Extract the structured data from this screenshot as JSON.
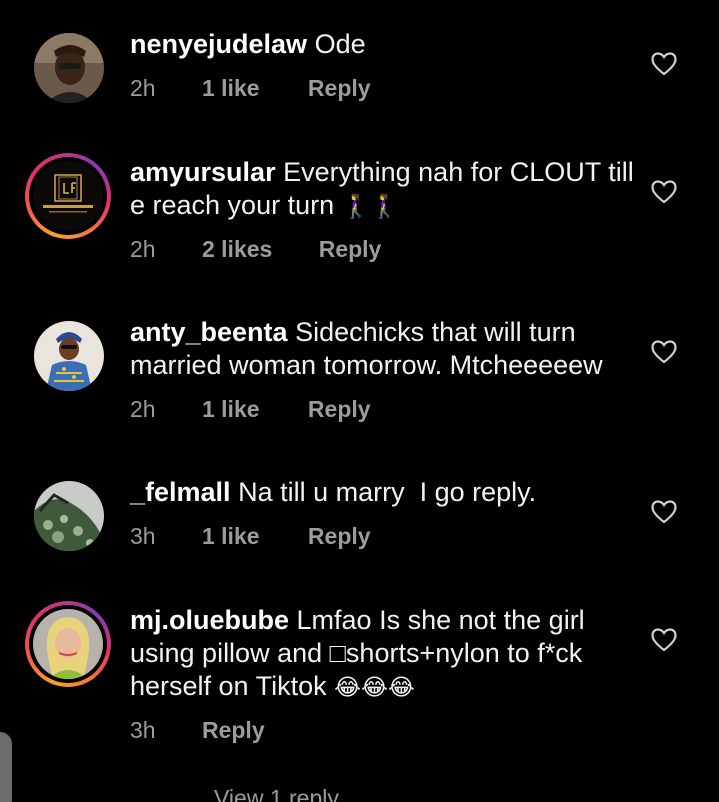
{
  "comments": [
    {
      "username": "nenyejudelaw",
      "text": "Ode",
      "time": "2h",
      "likes": "1 like",
      "reply": "Reply",
      "emoji": ""
    },
    {
      "username": "amyursular",
      "text": "Everything nah for CLOUT till e reach your turn",
      "time": "2h",
      "likes": "2 likes",
      "reply": "Reply",
      "emoji": "🚶‍♀️🚶‍♀️"
    },
    {
      "username": "anty_beenta",
      "text": "Sidechicks that will turn married woman tomorrow. Mtcheeeeew",
      "time": "2h",
      "likes": "1 like",
      "reply": "Reply",
      "emoji": ""
    },
    {
      "username": "_felmall",
      "text": "Na till u marry  I go reply.",
      "time": "3h",
      "likes": "1 like",
      "reply": "Reply",
      "emoji": ""
    },
    {
      "username": "mj.oluebube",
      "text": "Lmfao Is she not the girl using pillow and □shorts+nylon to f*ck herself on Tiktok",
      "time": "3h",
      "likes": "",
      "reply": "Reply",
      "emoji": "😂😂😂"
    }
  ],
  "view_replies": "View 1 reply",
  "colors": {
    "background": "#000000",
    "meta": "#9c9c9c",
    "story_ring": "#e1306c"
  },
  "icons": [
    "heart-outline-icon"
  ]
}
